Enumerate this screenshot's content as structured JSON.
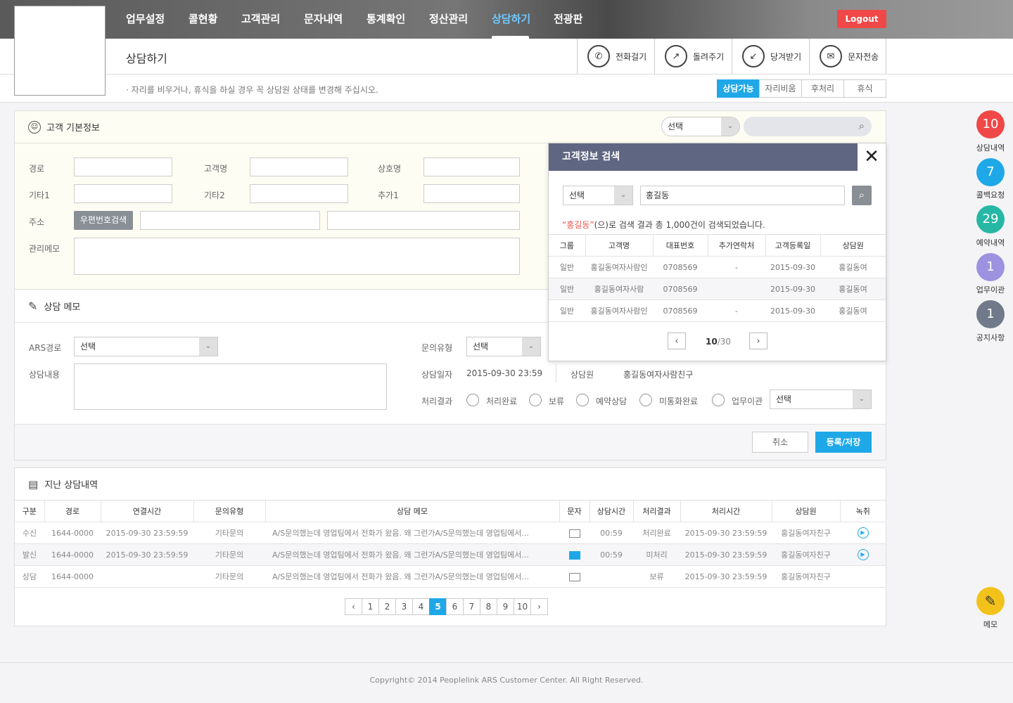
{
  "nav": {
    "items": [
      "업무설정",
      "콜현황",
      "고객관리",
      "문자내역",
      "통계확인",
      "정산관리",
      "상담하기",
      "전광판"
    ],
    "active": "상담하기",
    "logout": "Logout"
  },
  "header": {
    "title": "상담하기",
    "actions": [
      "전화걸기",
      "돌려주기",
      "당겨받기",
      "문자전송"
    ]
  },
  "notice": "· 자리를 비우거나, 휴식을 하실 경우 꼭 상담원 상태를 변경해 주십시오.",
  "status_buttons": [
    "상담가능",
    "자리비움",
    "후처리",
    "휴식"
  ],
  "status_active": "상담가능",
  "customer": {
    "title": "고객 기본정보",
    "search_select": "선택",
    "labels": {
      "route": "경로",
      "name": "고객명",
      "company": "상호명",
      "etc1": "기타1",
      "etc2": "기타2",
      "add1": "추가1",
      "address": "주소",
      "memo": "관리메모"
    },
    "zip_button": "우편번호검색"
  },
  "consult": {
    "title": "상담 메모",
    "ars_label": "ARS경로",
    "ars_value": "선택",
    "content_label": "상담내용",
    "type_label": "문의유형",
    "type_value": "선택",
    "date_label": "상담일자",
    "date_value": "2015-09-30 23:59",
    "agent_label": "상담원",
    "agent_value": "홍길동여자사람친구",
    "result_label": "처리결과",
    "results": [
      "처리완료",
      "보류",
      "예약상담",
      "미통화완료",
      "업무이관"
    ],
    "result_select": "선택",
    "cancel": "취소",
    "save": "등록/저장"
  },
  "popup": {
    "title": "고객정보 검색",
    "select": "선택",
    "query": "홍길동",
    "result_keyword": "“홍길동”",
    "result_text": "(으)로 검색 결과 총 1,000건이 검색되었습니다.",
    "columns": [
      "그룹",
      "고객명",
      "대표번호",
      "추가연락처",
      "고객등록일",
      "상담원"
    ],
    "rows": [
      [
        "일반",
        "홍길동여자사람인",
        "0708569",
        "-",
        "2015-09-30",
        "홍길동여"
      ],
      [
        "일반",
        "홍길동여자사람",
        "0708569",
        "",
        "2015-09-30",
        "홍길동여"
      ],
      [
        "일반",
        "홍길동여자사람인",
        "0708569",
        "-",
        "2015-09-30",
        "홍길동여"
      ]
    ],
    "page_current": "10",
    "page_total": "/30"
  },
  "history": {
    "title": "지난 상담내역",
    "columns": [
      "구분",
      "경로",
      "연결시간",
      "문의유형",
      "상담 메모",
      "문자",
      "상담시간",
      "처리결과",
      "처리시간",
      "상담원",
      "녹취"
    ],
    "rows": [
      {
        "type": "수신",
        "route": "1644-0000",
        "connect": "2015-09-30 23:59:59",
        "inquiry": "기타문의",
        "memo": "A/S문의했는데 영업팀에서 전화가 왔음. 왜 그런가A/S문의했는데 영업팀에서...",
        "sms": "off",
        "duration": "00:59",
        "result": "처리완료",
        "done": "2015-09-30 23:59:59",
        "agent": "홍길동여자친구",
        "rec": true
      },
      {
        "type": "발신",
        "route": "1644-0000",
        "connect": "2015-09-30 23:59:59",
        "inquiry": "기타문의",
        "memo": "A/S문의했는데 영업팀에서 전화가 왔음. 왜 그런가A/S문의했는데 영업팀에서...",
        "sms": "on",
        "duration": "00:59",
        "result": "미처리",
        "done": "2015-09-30 23:59:59",
        "agent": "홍길동여자친구",
        "rec": true
      },
      {
        "type": "상담",
        "route": "1644-0000",
        "connect": "",
        "inquiry": "기타문의",
        "memo": "A/S문의했는데 영업팀에서 전화가 왔음. 왜 그런가A/S문의했는데 영업팀에서...",
        "sms": "off",
        "duration": "",
        "result": "보류",
        "done": "2015-09-30 23:59:59",
        "agent": "홍길동여자친구",
        "rec": false
      }
    ],
    "pages": [
      "1",
      "2",
      "3",
      "4",
      "5",
      "6",
      "7",
      "8",
      "9",
      "10"
    ],
    "current_page": "5"
  },
  "side": [
    {
      "count": "10",
      "label": "상담내역",
      "color": "#f04848"
    },
    {
      "count": "7",
      "label": "콜백요청",
      "color": "#1fa8e8"
    },
    {
      "count": "29",
      "label": "예약내역",
      "color": "#26b8a5"
    },
    {
      "count": "1",
      "label": "업무이관",
      "color": "#9d92e0"
    },
    {
      "count": "1",
      "label": "공지사항",
      "color": "#707a8a"
    }
  ],
  "memo_button": "메모",
  "footer": "Copyright© 2014 Peoplelink ARS Customer Center. All Right Reserved."
}
